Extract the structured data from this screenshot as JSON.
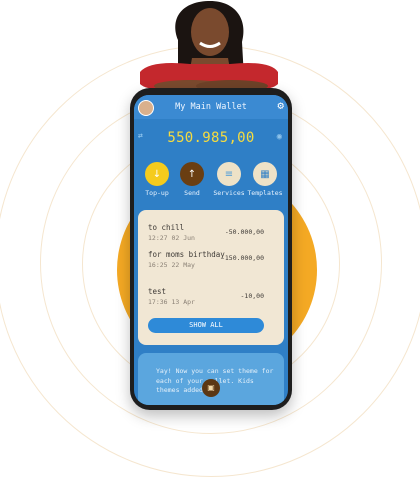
{
  "colors": {
    "accent": "#2f7fc6",
    "balance": "#f6dc3f",
    "sun": "#f4a924",
    "panel": "#f1e7d4"
  },
  "header": {
    "title": "My Main Wallet",
    "settings_icon": "gear-icon"
  },
  "balance": {
    "amount": "550.985,00"
  },
  "actions": [
    {
      "label": "Top-up",
      "icon": "arrow-down-icon",
      "color": "#f5cb1d"
    },
    {
      "label": "Send",
      "icon": "arrow-up-icon",
      "color": "#6a3e12"
    },
    {
      "label": "Services",
      "icon": "menu-icon",
      "color": "#eee2c7"
    },
    {
      "label": "Templates",
      "icon": "grid-icon",
      "color": "#eee2c7"
    }
  ],
  "transactions": [
    {
      "name": "to chill",
      "date": "12:27 02 Jun",
      "amount": "-50.000,00"
    },
    {
      "name": "for moms birthday",
      "date": "16:25 22 May",
      "amount": "-150.000,00"
    },
    {
      "name": "test",
      "date": "17:36 13 Apr",
      "amount": "-10,00"
    }
  ],
  "show_all_label": "SHOW ALL",
  "promo": {
    "text": "Yay! Now you can set theme for each of your wallet. Kids themes added!"
  }
}
